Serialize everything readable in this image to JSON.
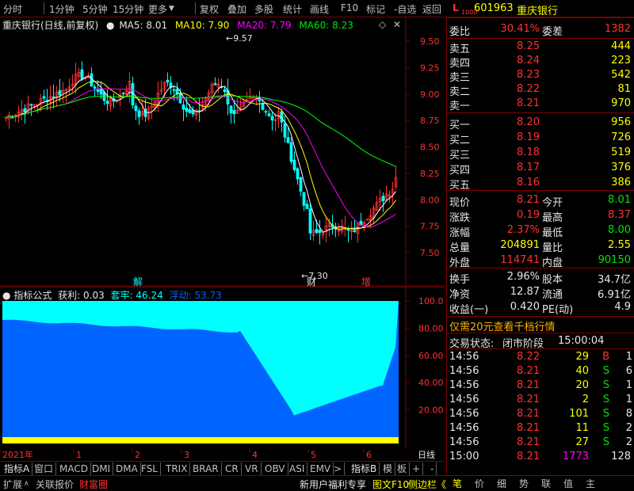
{
  "topbar": {
    "items": [
      "分时",
      "1分钟",
      "5分钟",
      "15分钟",
      "更多",
      "复权",
      "叠加",
      "多股",
      "统计",
      "画线",
      "F10",
      "标记",
      "-自选",
      "返回"
    ]
  },
  "main": {
    "title": "重庆银行(日线,前复权)",
    "ma5": "MA5: 8.01",
    "ma10": "MA10: 7.90",
    "ma20": "MA20: 7.79",
    "ma60": "MA60: 8.23",
    "high_marker": "9.57",
    "low_marker": "7.30",
    "event_labels": [
      "解",
      "财",
      "增"
    ],
    "price_ticks": [
      "9.50",
      "9.25",
      "9.00",
      "8.75",
      "8.50",
      "8.25",
      "8.00",
      "7.75",
      "7.50"
    ]
  },
  "indicator": {
    "title": "指标公式",
    "profit": "获利: 0.03",
    "trapped": "套牢: 46.24",
    "floating": "浮动: 53.73",
    "ticks": [
      "100.0",
      "80.00",
      "60.00",
      "40.00",
      "20.00"
    ]
  },
  "timeaxis": {
    "labels": [
      "2021年",
      "1",
      "2",
      "3",
      "4",
      "5",
      "6"
    ],
    "period": "日线"
  },
  "tabs": [
    "指标A",
    "窗口",
    "MACD",
    "DMI",
    "DMA",
    "FSL",
    "TRIX",
    "BRAR",
    "CR",
    "VR",
    "OBV",
    "ASI",
    "EMV",
    ">",
    "指标B",
    "模",
    "板",
    "+",
    "-"
  ],
  "bottombar": {
    "left": [
      "扩展",
      "关联报价",
      "财富圈"
    ],
    "right": [
      "新用户福利专享",
      "图文F10",
      "侧边栏《"
    ],
    "icons": [
      "笔",
      "价",
      "细",
      "势",
      "联",
      "值",
      "主"
    ]
  },
  "quote": {
    "code": "601963",
    "name": "重庆银行",
    "weibi_label": "委比",
    "weibi": "30.41%",
    "weicha_label": "委差",
    "weicha": "1382",
    "sell": [
      {
        "label": "卖五",
        "price": "8.25",
        "vol": "444"
      },
      {
        "label": "卖四",
        "price": "8.24",
        "vol": "223"
      },
      {
        "label": "卖三",
        "price": "8.23",
        "vol": "542"
      },
      {
        "label": "卖二",
        "price": "8.22",
        "vol": "81"
      },
      {
        "label": "卖一",
        "price": "8.21",
        "vol": "970"
      }
    ],
    "buy": [
      {
        "label": "买一",
        "price": "8.20",
        "vol": "956"
      },
      {
        "label": "买二",
        "price": "8.19",
        "vol": "726"
      },
      {
        "label": "买三",
        "price": "8.18",
        "vol": "519"
      },
      {
        "label": "买四",
        "price": "8.17",
        "vol": "376"
      },
      {
        "label": "买五",
        "price": "8.16",
        "vol": "386"
      }
    ],
    "stats": [
      {
        "l1": "现价",
        "v1": "8.21",
        "l2": "今开",
        "v2": "8.01"
      },
      {
        "l1": "涨跌",
        "v1": "0.19",
        "l2": "最高",
        "v2": "8.37"
      },
      {
        "l1": "涨幅",
        "v1": "2.37%",
        "l2": "最低",
        "v2": "8.00"
      },
      {
        "l1": "总量",
        "v1": "204891",
        "l2": "量比",
        "v2": "2.55"
      },
      {
        "l1": "外盘",
        "v1": "114741",
        "l2": "内盘",
        "v2": "90150"
      }
    ],
    "stats2": [
      {
        "l1": "换手",
        "v1": "2.96%",
        "l2": "股本",
        "v2": "34.7亿"
      },
      {
        "l1": "净资",
        "v1": "12.87",
        "l2": "流通",
        "v2": "6.91亿"
      },
      {
        "l1": "收益(一)",
        "v1": "0.420",
        "l2": "PE(动)",
        "v2": "4.9"
      }
    ],
    "promo": "仅需20元查看千档行情",
    "status_label": "交易状态:",
    "status": "闭市阶段",
    "status_time": "15:00:04",
    "ticks": [
      {
        "time": "14:56",
        "price": "8.22",
        "vol": "29",
        "side": "B"
      },
      {
        "time": "14:56",
        "price": "8.21",
        "vol": "40",
        "side": "S"
      },
      {
        "time": "14:56",
        "price": "8.21",
        "vol": "20",
        "side": "S"
      },
      {
        "time": "14:56",
        "price": "8.21",
        "vol": "2",
        "side": "S"
      },
      {
        "time": "14:56",
        "price": "8.21",
        "vol": "101",
        "side": "S"
      },
      {
        "time": "14:56",
        "price": "8.21",
        "vol": "11",
        "side": "S"
      },
      {
        "time": "14:56",
        "price": "8.21",
        "vol": "27",
        "side": "S"
      },
      {
        "time": "15:00",
        "price": "8.21",
        "vol": "1773",
        "side": "128"
      }
    ],
    "extra_cols": [
      "1",
      "6",
      "1",
      "1",
      "8",
      "2",
      "2",
      ""
    ]
  },
  "colors": {
    "up": "#ff3232",
    "down": "#00ffff",
    "ma5": "#ffffff",
    "ma10": "#ffff00",
    "ma20": "#ff00ff",
    "ma60": "#00ff00",
    "grid": "#800000"
  }
}
